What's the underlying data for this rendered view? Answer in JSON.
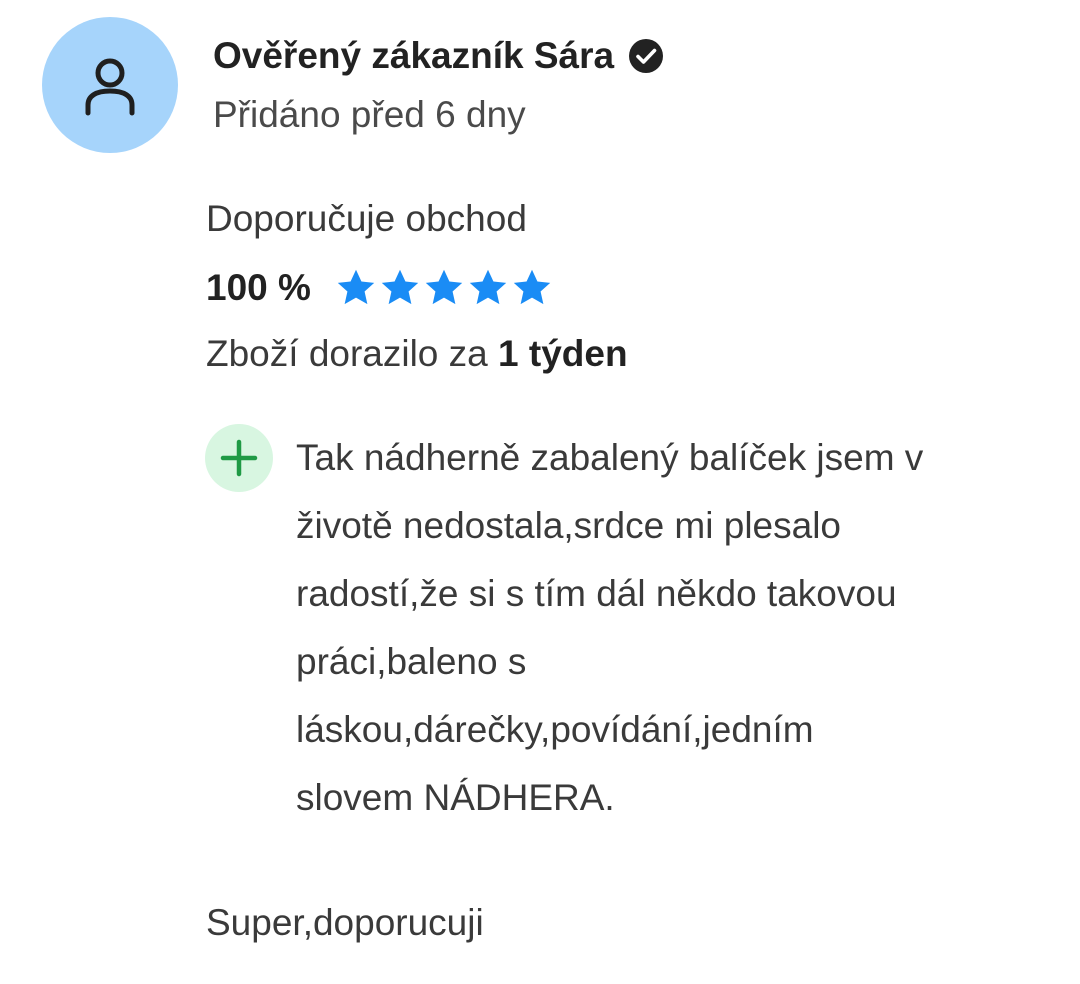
{
  "review": {
    "author_name": "Ověřený zákazník Sára",
    "added": "Přidáno před 6 dny",
    "recommends_label": "Doporučuje obchod",
    "recommend_percent": "100 %",
    "stars": 5,
    "star_color": "#1a8cf5",
    "delivery_prefix": "Zboží dorazilo za",
    "delivery_value": "1 týden",
    "positive_text": "Tak nádherně zabalený balíček jsem v\nživotě nedostala,srdce mi plesalo\nradostí,že si s tím dál někdo takovou\npráci,baleno s\nláskou,dárečky,povídání,jedním\nslovem NÁDHERA.",
    "footer_text": "Super,doporucuji"
  },
  "icons": {
    "avatar": "user-icon",
    "verified": "verified-check-icon",
    "positive": "plus-icon",
    "star": "star-icon"
  },
  "colors": {
    "avatar_bg": "#a6d4fb",
    "positive_bg": "#d8f6e1",
    "positive_fg": "#1f9a45"
  }
}
